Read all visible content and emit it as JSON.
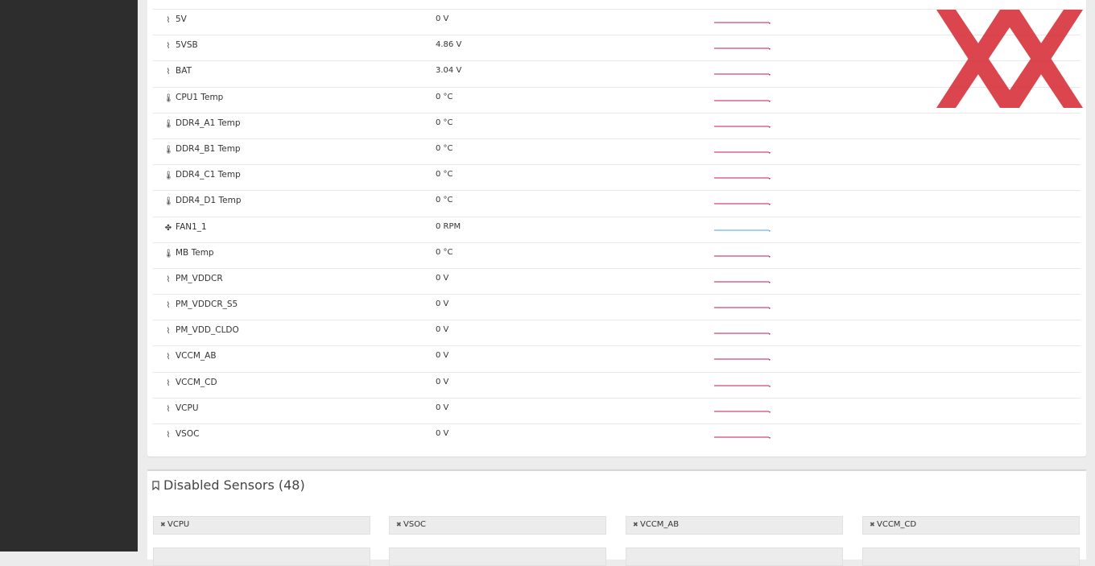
{
  "sensors": [
    {
      "icon": "voltage-icon",
      "glyph": "⌇",
      "name": "5V",
      "value": "0 V",
      "color": "#c2185b"
    },
    {
      "icon": "voltage-icon",
      "glyph": "⌇",
      "name": "5VSB",
      "value": "4.86 V",
      "color": "#c2185b"
    },
    {
      "icon": "voltage-icon",
      "glyph": "⌇",
      "name": "BAT",
      "value": "3.04 V",
      "color": "#c2185b"
    },
    {
      "icon": "thermometer-icon",
      "glyph": "🌡",
      "name": "CPU1 Temp",
      "value": "0 °C",
      "color": "#c2185b"
    },
    {
      "icon": "thermometer-icon",
      "glyph": "🌡",
      "name": "DDR4_A1 Temp",
      "value": "0 °C",
      "color": "#c2185b"
    },
    {
      "icon": "thermometer-icon",
      "glyph": "🌡",
      "name": "DDR4_B1 Temp",
      "value": "0 °C",
      "color": "#c2185b"
    },
    {
      "icon": "thermometer-icon",
      "glyph": "🌡",
      "name": "DDR4_C1 Temp",
      "value": "0 °C",
      "color": "#c2185b"
    },
    {
      "icon": "thermometer-icon",
      "glyph": "🌡",
      "name": "DDR4_D1 Temp",
      "value": "0 °C",
      "color": "#c2185b"
    },
    {
      "icon": "fan-icon",
      "glyph": "✤",
      "name": "FAN1_1",
      "value": "0 RPM",
      "color": "#4aa3d8"
    },
    {
      "icon": "thermometer-icon",
      "glyph": "🌡",
      "name": "MB Temp",
      "value": "0 °C",
      "color": "#c2185b"
    },
    {
      "icon": "voltage-icon",
      "glyph": "⌇",
      "name": "PM_VDDCR",
      "value": "0 V",
      "color": "#c2185b"
    },
    {
      "icon": "voltage-icon",
      "glyph": "⌇",
      "name": "PM_VDDCR_S5",
      "value": "0 V",
      "color": "#c2185b"
    },
    {
      "icon": "voltage-icon",
      "glyph": "⌇",
      "name": "PM_VDD_CLDO",
      "value": "0 V",
      "color": "#c2185b"
    },
    {
      "icon": "voltage-icon",
      "glyph": "⌇",
      "name": "VCCM_AB",
      "value": "0 V",
      "color": "#c2185b"
    },
    {
      "icon": "voltage-icon",
      "glyph": "⌇",
      "name": "VCCM_CD",
      "value": "0 V",
      "color": "#c2185b"
    },
    {
      "icon": "voltage-icon",
      "glyph": "⌇",
      "name": "VCPU",
      "value": "0 V",
      "color": "#c2185b"
    },
    {
      "icon": "voltage-icon",
      "glyph": "⌇",
      "name": "VSOC",
      "value": "0 V",
      "color": "#c2185b"
    }
  ],
  "disabled": {
    "title": "Disabled Sensors (48)",
    "chips": [
      "VCPU",
      "VSOC",
      "VCCM_AB",
      "VCCM_CD",
      "",
      "",
      "",
      ""
    ]
  },
  "colors": {
    "sidebar": "#2d2d2d",
    "logo": "#d9363e",
    "spark_voltage": "#c2185b",
    "spark_fan": "#4aa3d8"
  }
}
